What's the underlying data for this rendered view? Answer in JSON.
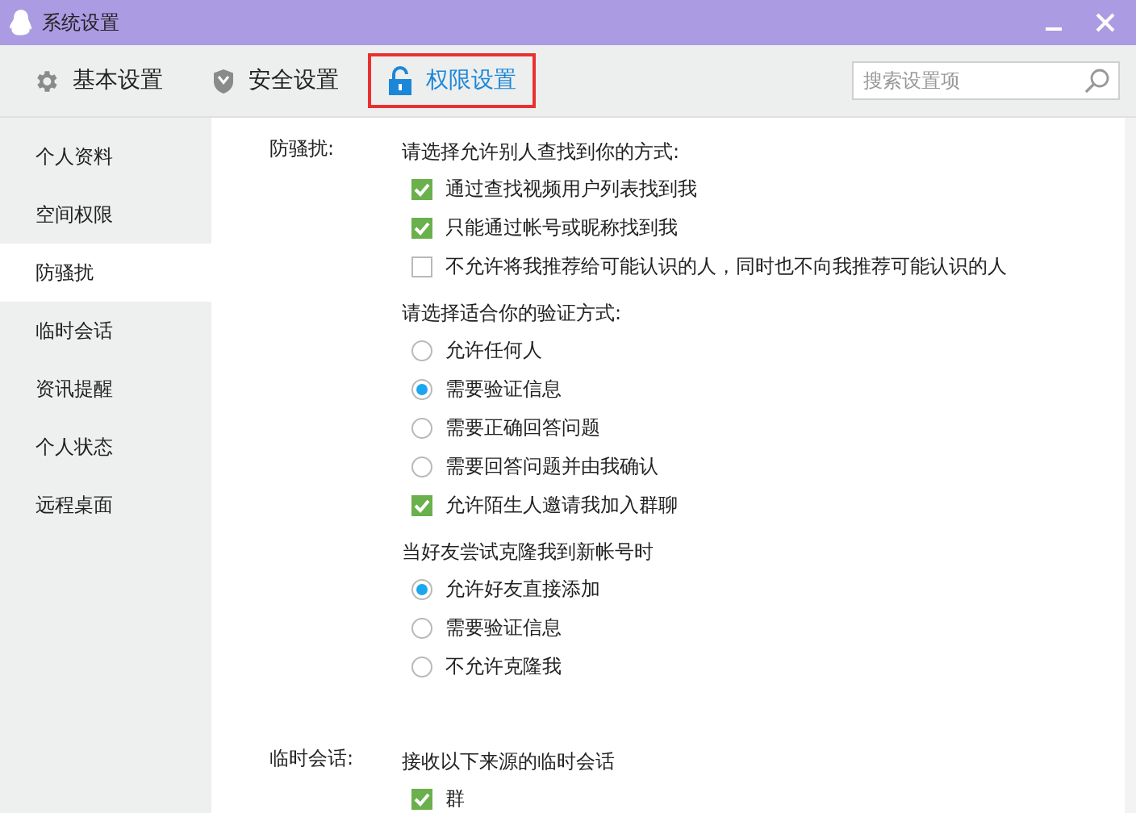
{
  "window": {
    "title": "系统设置"
  },
  "tabs": [
    {
      "label": "基本设置",
      "kind": "gear",
      "selected": false
    },
    {
      "label": "安全设置",
      "kind": "shield",
      "selected": false
    },
    {
      "label": "权限设置",
      "kind": "lock",
      "selected": true
    }
  ],
  "search": {
    "placeholder": "搜索设置项"
  },
  "sidebar": {
    "items": [
      {
        "label": "个人资料",
        "selected": false
      },
      {
        "label": "空间权限",
        "selected": false
      },
      {
        "label": "防骚扰",
        "selected": true
      },
      {
        "label": "临时会话",
        "selected": false
      },
      {
        "label": "资讯提醒",
        "selected": false
      },
      {
        "label": "个人状态",
        "selected": false
      },
      {
        "label": "远程桌面",
        "selected": false
      }
    ]
  },
  "sections": [
    {
      "label": "防骚扰:",
      "groups": [
        {
          "heading": "请选择允许别人查找到你的方式:",
          "items": [
            {
              "kind": "checkbox",
              "label": "通过查找视频用户列表找到我",
              "checked": true
            },
            {
              "kind": "checkbox",
              "label": "只能通过帐号或昵称找到我",
              "checked": true
            },
            {
              "kind": "checkbox",
              "label": "不允许将我推荐给可能认识的人，同时也不向我推荐可能认识的人",
              "checked": false
            }
          ]
        },
        {
          "heading": "请选择适合你的验证方式:",
          "items": [
            {
              "kind": "radio",
              "label": "允许任何人",
              "selected": false
            },
            {
              "kind": "radio",
              "label": "需要验证信息",
              "selected": true
            },
            {
              "kind": "radio",
              "label": "需要正确回答问题",
              "selected": false
            },
            {
              "kind": "radio",
              "label": "需要回答问题并由我确认",
              "selected": false
            },
            {
              "kind": "checkbox",
              "label": "允许陌生人邀请我加入群聊",
              "checked": true
            }
          ]
        },
        {
          "heading": "当好友尝试克隆我到新帐号时",
          "items": [
            {
              "kind": "radio",
              "label": "允许好友直接添加",
              "selected": true
            },
            {
              "kind": "radio",
              "label": "需要验证信息",
              "selected": false
            },
            {
              "kind": "radio",
              "label": "不允许克隆我",
              "selected": false
            }
          ]
        }
      ]
    },
    {
      "label": "临时会话:",
      "groups": [
        {
          "heading": "接收以下来源的临时会话",
          "items": [
            {
              "kind": "checkbox",
              "label": "群",
              "checked": true
            }
          ]
        }
      ]
    }
  ]
}
